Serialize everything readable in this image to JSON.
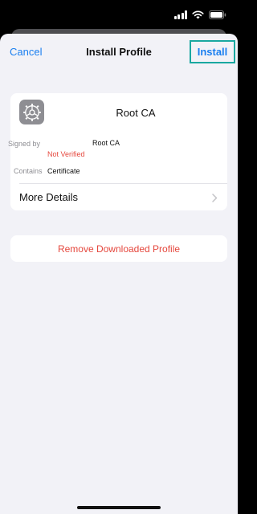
{
  "status_bar": {
    "signal_icon": "cellular-signal-icon",
    "wifi_icon": "wifi-icon",
    "battery_icon": "battery-icon"
  },
  "nav": {
    "cancel_label": "Cancel",
    "title": "Install Profile",
    "install_label": "Install"
  },
  "profile": {
    "icon": "settings-gear-icon",
    "name": "Root CA",
    "signed_by_label": "Signed by",
    "signed_by_value": "Root CA",
    "verification_status": "Not Verified",
    "contains_label": "Contains",
    "contains_value": "Certificate",
    "more_details_label": "More Details",
    "chevron_icon": "chevron-right-icon"
  },
  "actions": {
    "remove_label": "Remove Downloaded Profile"
  },
  "colors": {
    "accent": "#1a7ff0",
    "destructive": "#e5473d",
    "highlight_border": "#1aa8a0",
    "background": "#f2f2f7"
  }
}
